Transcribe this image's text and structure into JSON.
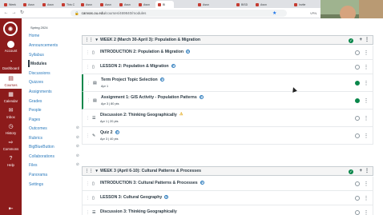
{
  "browser": {
    "tabs": [
      {
        "label": "Week"
      },
      {
        "label": "Assn"
      },
      {
        "label": "Assn"
      },
      {
        "label": "This C"
      },
      {
        "label": "Assn"
      },
      {
        "label": "Assn"
      },
      {
        "label": "Assn"
      },
      {
        "label": "Assn"
      },
      {
        "label": "Bl"
      },
      {
        "label": "Assn"
      },
      {
        "label": "BISD"
      },
      {
        "label": "Assn"
      },
      {
        "label": "Invite"
      }
    ],
    "url_host": "canvas.ou.edu",
    "url_path": "/courses/469840/modules",
    "vpn": "VPN"
  },
  "webcam": {
    "name": "Randy Peppler"
  },
  "global_nav": {
    "items": [
      {
        "label": "Account"
      },
      {
        "label": "Dashboard"
      },
      {
        "label": "Courses"
      },
      {
        "label": "Calendar"
      },
      {
        "label": "Inbox"
      },
      {
        "label": "History"
      },
      {
        "label": "Commons"
      },
      {
        "label": "Help"
      }
    ],
    "inbox_count": "1"
  },
  "course_nav": {
    "term": "Spring 2024",
    "items": [
      {
        "label": "Home"
      },
      {
        "label": "Announcements"
      },
      {
        "label": "Syllabus"
      },
      {
        "label": "Modules"
      },
      {
        "label": "Discussions"
      },
      {
        "label": "Quizzes"
      },
      {
        "label": "Assignments"
      },
      {
        "label": "Grades"
      },
      {
        "label": "People"
      },
      {
        "label": "Pages"
      },
      {
        "label": "Outcomes"
      },
      {
        "label": "Rubrics"
      },
      {
        "label": "BigBlueButton"
      },
      {
        "label": "Collaborations"
      },
      {
        "label": "Files"
      },
      {
        "label": "Panorama"
      },
      {
        "label": "Settings"
      }
    ]
  },
  "modules": [
    {
      "title": "WEEK 2 (March 30-April 3): Population & Migration",
      "items": [
        {
          "title": "INTRODUCTION 2: Population & Migration",
          "meta": ""
        },
        {
          "title": "LESSON 2: Population & Migration",
          "meta": ""
        },
        {
          "title": "Term Project Topic Selection",
          "meta": "Apr 1"
        },
        {
          "title": "Assignment 1: GIS Activity - Population Patterns",
          "meta": "Apr 3 | 80 pts"
        },
        {
          "title": "Discussion 2: Thinking Geographically",
          "meta": "Apr 1 | 20 pts"
        },
        {
          "title": "Quiz 2",
          "meta": "Apr 3 | 40 pts"
        }
      ]
    },
    {
      "title": "WEEK 3 (April 6-10): Cultural Patterns & Processes",
      "items": [
        {
          "title": "INTRODUCTION 3: Cultural Patterns & Processes",
          "meta": ""
        },
        {
          "title": "LESSON 3: Cultural Geography",
          "meta": ""
        },
        {
          "title": "Discussion 3: Thinking Geographically",
          "meta": ""
        }
      ]
    }
  ]
}
